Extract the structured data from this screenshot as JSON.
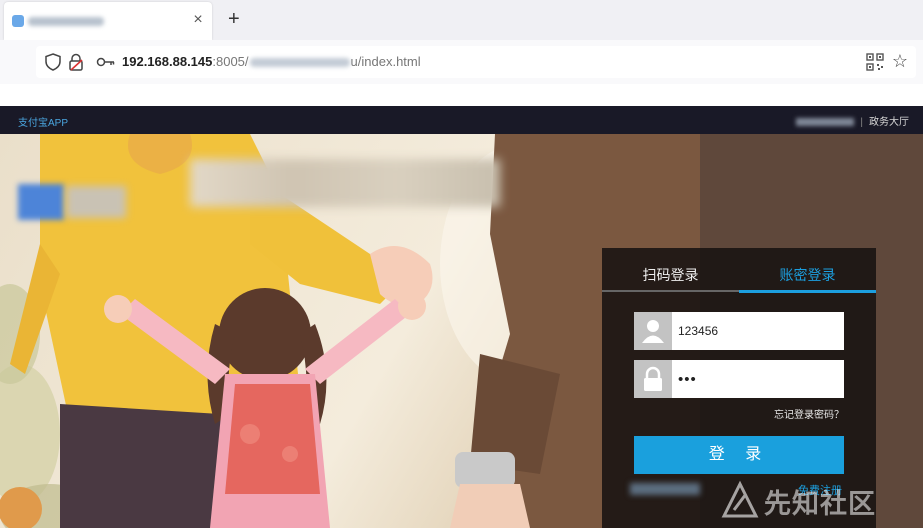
{
  "browser": {
    "new_tab_symbol": "+",
    "close_symbol": "×",
    "url": {
      "host": "192.168.88.145",
      "port": ":8005/",
      "path_tail": "u/index.html"
    }
  },
  "page": {
    "top_bar": {
      "left_link": "支付宝APP",
      "right_link": "政务大厅",
      "separator": "|"
    },
    "login": {
      "tabs": [
        "扫码登录",
        "账密登录"
      ],
      "active_tab": 1,
      "username_value": "123456",
      "password_value": "•••",
      "forgot_link": "忘记登录密码？",
      "submit_label": "登 录",
      "register_link": "免费注册"
    },
    "watermark": "先知社区"
  },
  "colors": {
    "accent": "#1aa0dd",
    "topbar": "#191927"
  },
  "icons": [
    "shield-icon",
    "lock-icon",
    "key-icon",
    "qr-code-icon",
    "star-icon",
    "user-icon",
    "padlock-icon",
    "watermark-logo-icon"
  ]
}
